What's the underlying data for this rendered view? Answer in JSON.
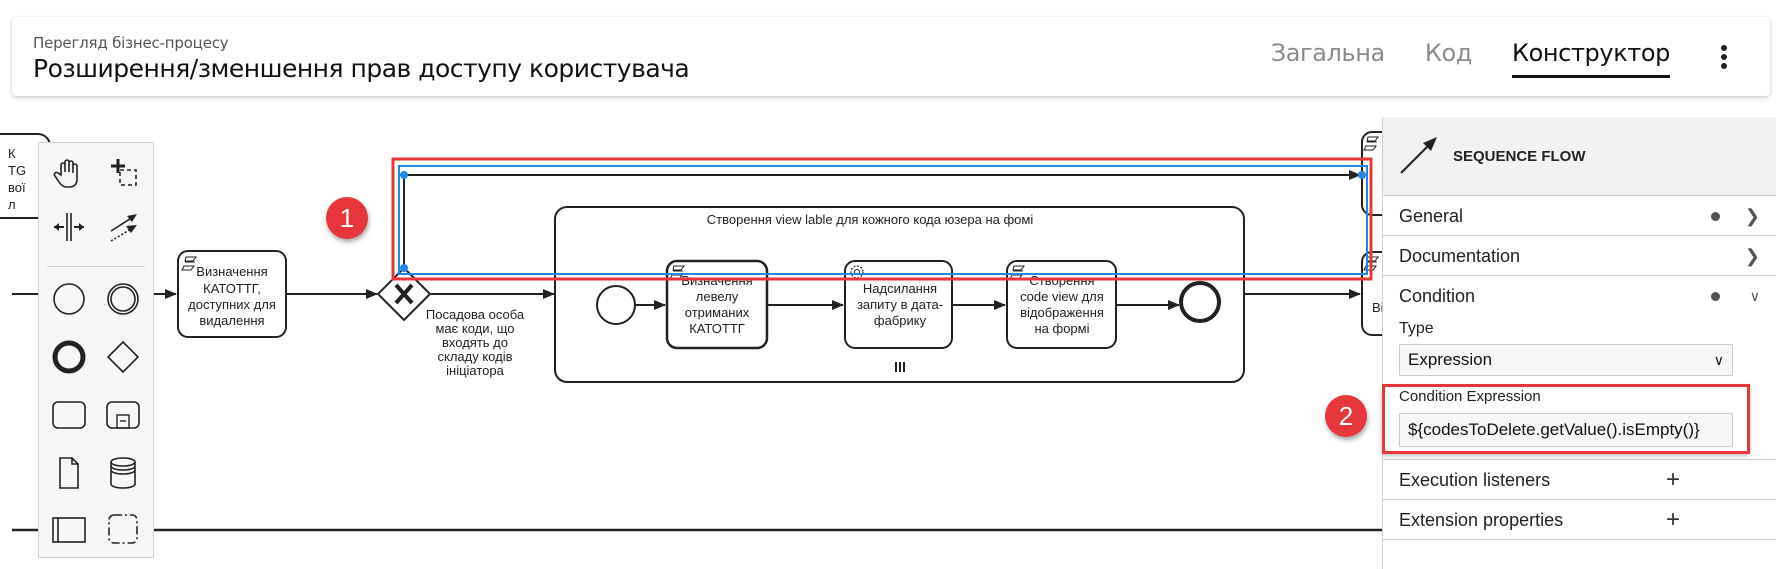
{
  "header": {
    "subtitle": "Перегляд бізнес-процесу",
    "title": "Розширення/зменшення прав доступу користувача",
    "tabs": [
      {
        "label": "Загальна",
        "active": false
      },
      {
        "label": "Код",
        "active": false
      },
      {
        "label": "Конструктор",
        "active": true
      }
    ],
    "menu_icon": "kebab-menu-icon"
  },
  "palette": {
    "tools": [
      {
        "name": "hand-tool",
        "icon": "hand-icon"
      },
      {
        "name": "lasso-tool",
        "icon": "lasso-icon"
      },
      {
        "name": "space-tool",
        "icon": "space-icon"
      },
      {
        "name": "global-connect-tool",
        "icon": "connect-icon"
      },
      {
        "name": "start-event",
        "icon": "circle-icon"
      },
      {
        "name": "intermediate-event",
        "icon": "double-circle-icon"
      },
      {
        "name": "end-event",
        "icon": "thick-circle-icon"
      },
      {
        "name": "gateway",
        "icon": "diamond-icon"
      },
      {
        "name": "task",
        "icon": "rounded-rect-icon"
      },
      {
        "name": "subprocess",
        "icon": "subprocess-icon"
      },
      {
        "name": "data-object",
        "icon": "document-icon"
      },
      {
        "name": "data-store",
        "icon": "database-icon"
      },
      {
        "name": "participant",
        "icon": "pool-icon"
      },
      {
        "name": "group",
        "icon": "dashed-rect-icon"
      }
    ]
  },
  "diagram": {
    "left_partial_task": [
      "К",
      "ТG",
      "вої",
      "л"
    ],
    "task_katottg": [
      "Визначення",
      "КАТОТТГ,",
      "доступних для",
      "видалення"
    ],
    "gateway_label": [
      "Посадова особа",
      "має коди, що",
      "входять до",
      "складу кодів",
      "ініціатора"
    ],
    "subprocess_title": "Створення view lable для кожного кода юзера на фомі",
    "sub_task_1": [
      "Визначення",
      "левелу",
      "отриманих",
      "КАТОТТГ"
    ],
    "sub_task_2": [
      "Надсилання",
      "запиту в дата-",
      "фабрику"
    ],
    "sub_task_3": [
      "Створення",
      "code view для",
      "відображення",
      "на формі"
    ],
    "right_partial_text": "Ві"
  },
  "annotations": {
    "badge_1": "1",
    "badge_2": "2"
  },
  "properties": {
    "element_type": "SEQUENCE FLOW",
    "groups": {
      "general": "General",
      "documentation": "Documentation",
      "condition": "Condition",
      "execution_listeners": "Execution listeners",
      "extension_properties": "Extension properties"
    },
    "condition": {
      "type_label": "Type",
      "type_value": "Expression",
      "expression_label": "Condition Expression",
      "expression_value": "${codesToDelete.getValue().isEmpty()}"
    }
  },
  "colors": {
    "highlight_red": "#e8373b",
    "selection_blue": "#1e88e5"
  }
}
